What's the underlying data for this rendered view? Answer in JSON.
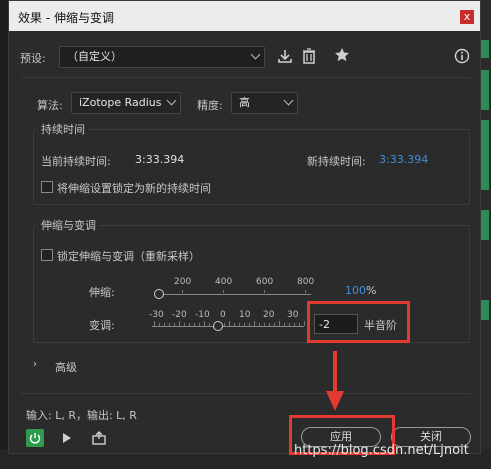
{
  "window": {
    "title": "效果 - 伸缩与变调",
    "close_label": "x"
  },
  "preset": {
    "label": "预设:",
    "value": "（自定义）"
  },
  "algorithm": {
    "label": "算法:",
    "value": "iZotope Radius",
    "precision_label": "精度:",
    "precision_value": "高"
  },
  "duration": {
    "group_title": "持续时间",
    "current_label": "当前持续时间:",
    "current_value": "3:33.394",
    "new_label": "新持续时间:",
    "new_value": "3:33.394",
    "lock_label": "将伸缩设置锁定为新的持续时间"
  },
  "stretch_pitch": {
    "group_title": "伸缩与变调",
    "lock_label": "锁定伸缩与变调（重新采样）",
    "stretch_label": "伸缩:",
    "stretch_ticks": [
      "200",
      "400",
      "600",
      "800"
    ],
    "stretch_value": "100",
    "stretch_unit": "%",
    "pitch_label": "变调:",
    "pitch_ticks": [
      "-30",
      "-20",
      "-10",
      "0",
      "10",
      "20",
      "30"
    ],
    "pitch_value": "-2",
    "pitch_unit": "半音阶"
  },
  "advanced": {
    "label": "高级"
  },
  "io": {
    "text": "输入: L, R，输出: L, R"
  },
  "buttons": {
    "apply": "应用",
    "close": "关闭"
  },
  "watermark": "https://blog.csdn.net/Ljnoit",
  "colors": {
    "accent_blue": "#3d8fe0",
    "highlight_red": "#e23a30",
    "power_green": "#2e9c4f"
  }
}
